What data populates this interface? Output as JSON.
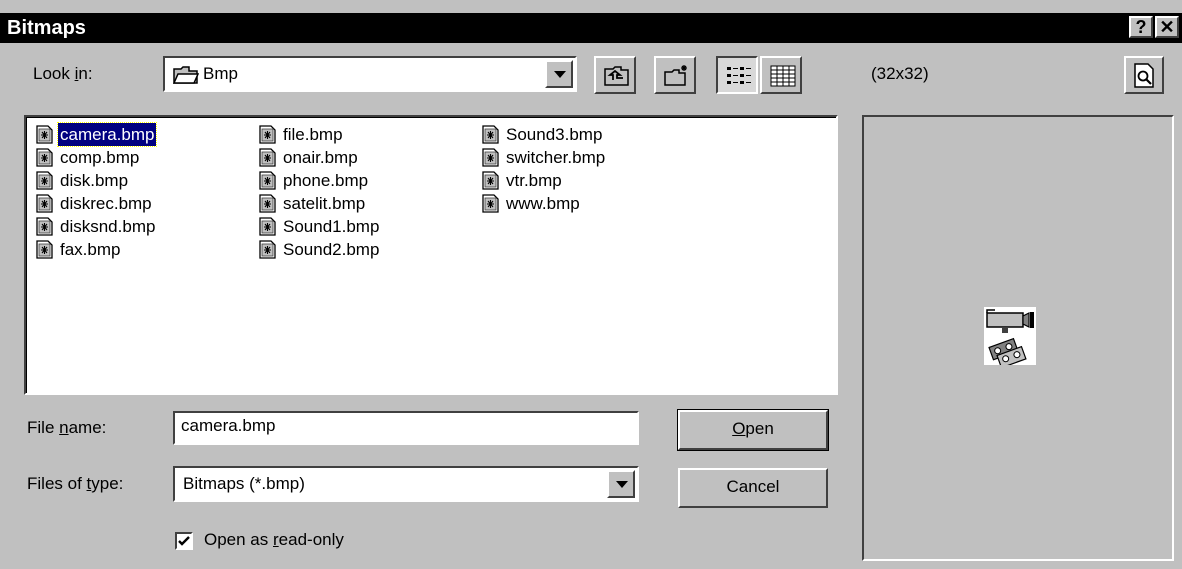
{
  "window": {
    "title": "Bitmaps",
    "help_label": "?",
    "close_label": "✕"
  },
  "lookin": {
    "label_pre": "Look ",
    "label_key": "i",
    "label_post": "n:",
    "value": "Bmp"
  },
  "files": {
    "columns": [
      [
        "camera.bmp",
        "comp.bmp",
        "disk.bmp",
        "diskrec.bmp",
        "disksnd.bmp",
        "fax.bmp"
      ],
      [
        "file.bmp",
        "onair.bmp",
        "phone.bmp",
        "satelit.bmp",
        "Sound1.bmp",
        "Sound2.bmp"
      ],
      [
        "Sound3.bmp",
        "switcher.bmp",
        "vtr.bmp",
        "www.bmp"
      ]
    ],
    "selected": "camera.bmp",
    "icon": "bitmap-file-icon"
  },
  "filename": {
    "label_pre": "File ",
    "label_key": "n",
    "label_post": "ame:",
    "value": "camera.bmp"
  },
  "filetype": {
    "label_pre": "Files of ",
    "label_key": "t",
    "label_post": "ype:",
    "value": "Bitmaps (*.bmp)"
  },
  "buttons": {
    "open_key": "O",
    "open_rest": "pen",
    "cancel": "Cancel"
  },
  "readonly": {
    "label_pre": "Open as ",
    "label_key": "r",
    "label_post": "ead-only",
    "checked": true
  },
  "preview": {
    "size_label": "(32x32)",
    "image": "camera-video-icon"
  },
  "toolbar": {
    "icons": [
      "up-one-level-icon",
      "create-new-folder-icon",
      "list-view-icon",
      "details-view-icon"
    ]
  }
}
